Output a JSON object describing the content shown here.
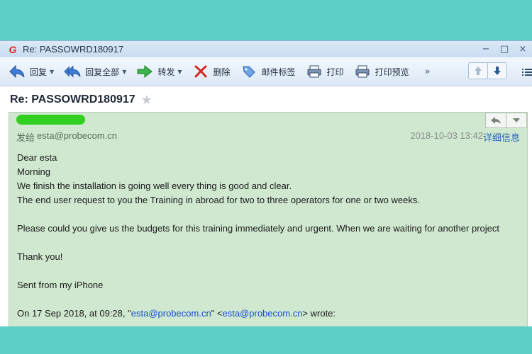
{
  "window": {
    "title": "Re: PASSOWRD180917",
    "logo_glyph": "G",
    "controls": [
      "−",
      "□",
      "×"
    ]
  },
  "toolbar": {
    "buttons": [
      {
        "label": "回复",
        "icon": "reply-icon",
        "has_menu": true
      },
      {
        "label": "回复全部",
        "icon": "reply-all-icon",
        "has_menu": true
      },
      {
        "label": "转发",
        "icon": "forward-icon",
        "has_menu": true
      },
      {
        "label": "删除",
        "icon": "delete-icon",
        "has_menu": false
      },
      {
        "label": "邮件标签",
        "icon": "tag-icon",
        "has_menu": false
      },
      {
        "label": "打印",
        "icon": "printer-icon",
        "has_menu": false
      },
      {
        "label": "打印预览",
        "icon": "print-preview-icon",
        "has_menu": false
      }
    ],
    "more": "»"
  },
  "subject": "Re: PASSOWRD180917",
  "message": {
    "to_label": "发给",
    "to": "esta@probecom.cn",
    "date": "2018-10-03 13:42",
    "details_link": "详细信息",
    "body": {
      "line1": "Dear esta",
      "line2": "Morning",
      "line3": "We finish the installation is going well every thing is good and clear.",
      "line4": "The end user request to you the Training in abroad for two to three operators for one or two weeks.",
      "line5": "Please could you give us the budgets for this training immediately and urgent. When we are waiting  for another project",
      "line6": "Thank you!",
      "line7": "Sent from my iPhone",
      "quote_prefix": "On 17 Sep 2018, at 09:28, \"",
      "quote_link1": "esta@probecom.cn",
      "quote_mid": "\" <",
      "quote_link2": "esta@probecom.cn",
      "quote_suffix": "> wrote:"
    }
  },
  "colors": {
    "background": "#5ecfc6",
    "message_bg": "#cfe8cf",
    "link": "#1a4fd0",
    "redaction": "#31d020"
  }
}
